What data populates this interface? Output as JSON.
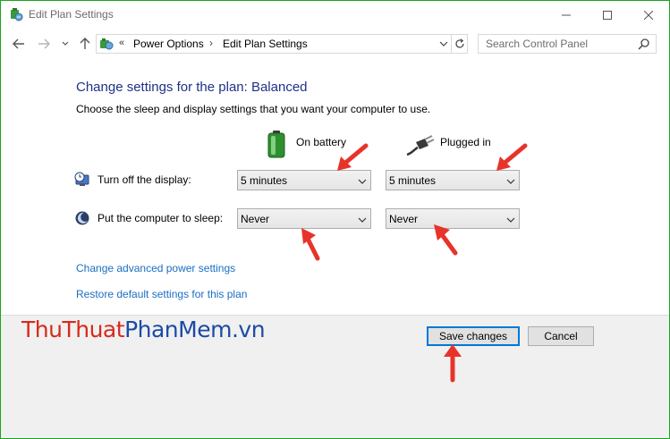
{
  "window": {
    "title": "Edit Plan Settings",
    "border_color": "#1aa61a"
  },
  "address_bar": {
    "overflow": "«",
    "breadcrumbs": [
      "Power Options",
      "Edit Plan Settings"
    ],
    "separator": "›"
  },
  "search": {
    "placeholder": "Search Control Panel"
  },
  "main": {
    "heading": "Change settings for the plan: Balanced",
    "description": "Choose the sleep and display settings that you want your computer to use.",
    "columns": {
      "on_battery": "On battery",
      "plugged_in": "Plugged in"
    },
    "settings": [
      {
        "label": "Turn off the display:",
        "on_battery": "5 minutes",
        "plugged_in": "5 minutes"
      },
      {
        "label": "Put the computer to sleep:",
        "on_battery": "Never",
        "plugged_in": "Never"
      }
    ],
    "links": {
      "advanced": "Change advanced power settings",
      "restore": "Restore default settings for this plan"
    }
  },
  "footer": {
    "save_label": "Save changes",
    "cancel_label": "Cancel"
  },
  "watermark": {
    "part1": "Thu",
    "part2": "Thuat",
    "part3": "PhanMem",
    "part4": ".vn"
  },
  "colors": {
    "heading": "#1e3287",
    "link": "#1b6ec2",
    "annotation_arrow": "#e8332a",
    "watermark_red": "#d72a1d",
    "watermark_blue": "#1c4aa6"
  }
}
